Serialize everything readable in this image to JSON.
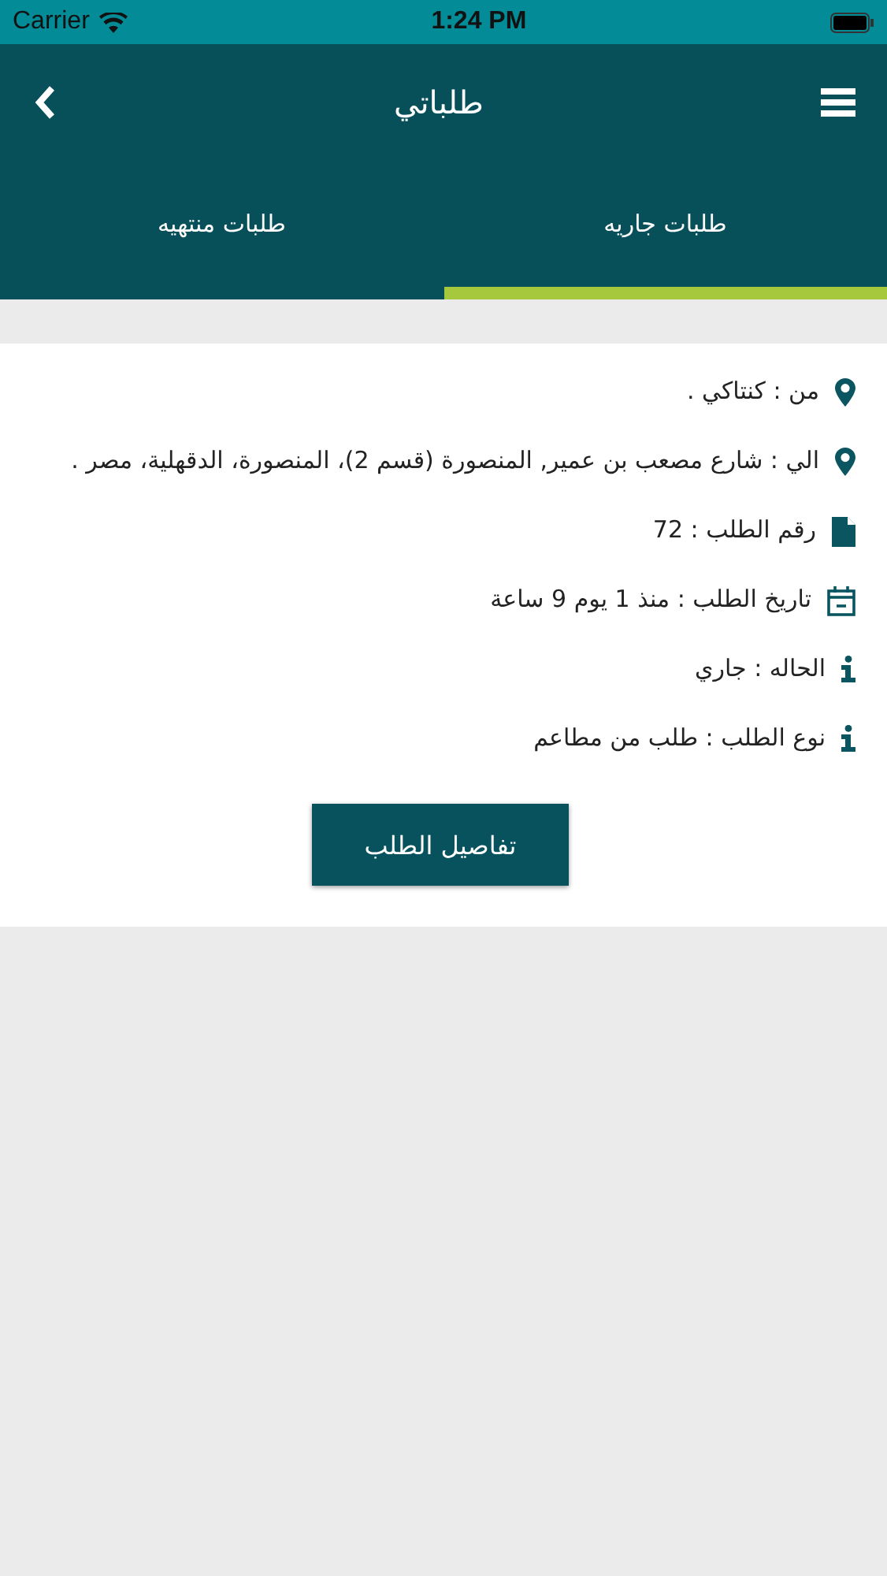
{
  "status_bar": {
    "carrier": "Carrier",
    "time": "1:24 PM"
  },
  "header": {
    "title": "طلباتي"
  },
  "tabs": [
    {
      "label": "طلبات جاريه",
      "selected": true
    },
    {
      "label": "طلبات منتهيه",
      "selected": false
    }
  ],
  "order": {
    "fields": [
      {
        "kind": "pin",
        "text": "من : كنتاكي ."
      },
      {
        "kind": "pin",
        "text": "الي : شارع مصعب بن عمير, المنصورة (قسم 2)، المنصورة، الدقهلية، مصر ."
      },
      {
        "kind": "file",
        "text": "رقم الطلب : 72"
      },
      {
        "kind": "calendar",
        "text": "تاريخ الطلب : منذ 1 يوم 9 ساعة"
      },
      {
        "kind": "info",
        "text": "الحاله : جاري"
      },
      {
        "kind": "info",
        "text": "نوع الطلب : طلب من مطاعم"
      }
    ],
    "button": "تفاصيل الطلب"
  }
}
